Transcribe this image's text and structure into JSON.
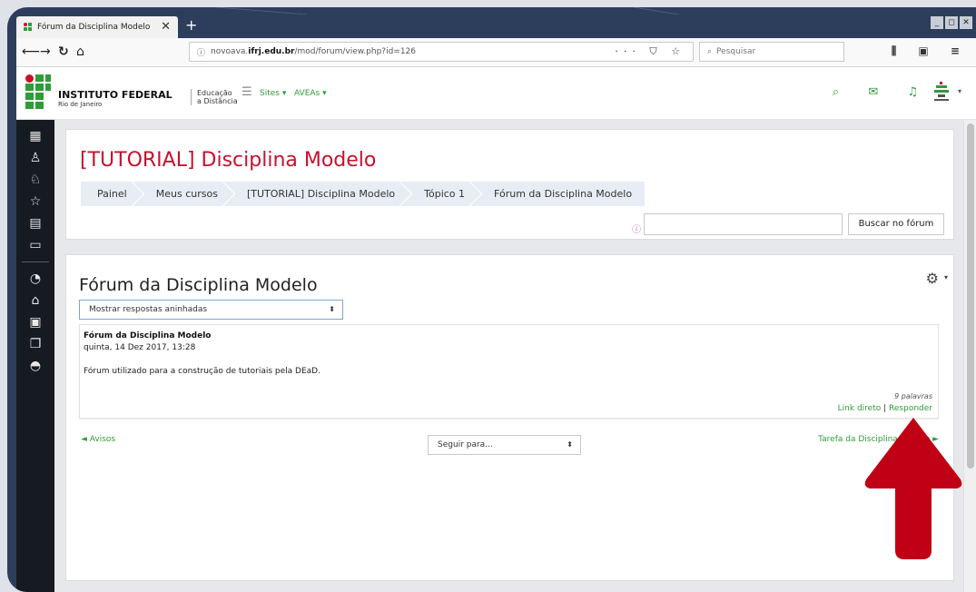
{
  "browser": {
    "tab_title": "Fórum da Disciplina Modelo",
    "tab_close": "✕",
    "new_tab": "+",
    "url_prefix": "novoava.",
    "url_domain": "ifrj.edu.br",
    "url_path": "/mod/forum/view.php?id=126",
    "search_placeholder": "Pesquisar",
    "url_icons": "··· ⛉ ☆",
    "nav_right_icons": "⫼ ▣ ≡"
  },
  "site": {
    "institute_name": "INSTITUTO FEDERAL",
    "institute_sub": "Rio de Janeiro",
    "ead_line1": "Educação",
    "ead_line2": "a Distância",
    "menu_sites": "Sites ▾",
    "menu_aveas": "AVEAs ▾",
    "header_icons": "⌕ ✉ ♫"
  },
  "drawer": {
    "icons": [
      "dashboard-icon",
      "users-icon",
      "badges-icon",
      "competencies-icon",
      "grades-icon",
      "folder-icon",
      "gauge-icon",
      "home-icon",
      "calendar-icon",
      "files-icon",
      "courses-icon"
    ]
  },
  "course": {
    "title": "[TUTORIAL] Disciplina Modelo",
    "breadcrumb": [
      "Painel",
      "Meus cursos",
      "[TUTORIAL] Disciplina Modelo",
      "Tópico 1",
      "Fórum da Disciplina Modelo"
    ],
    "search_button": "Buscar no fórum"
  },
  "forum": {
    "title": "Fórum da Disciplina Modelo",
    "display_mode": "Mostrar respostas aninhadas",
    "post": {
      "subject": "Fórum da Disciplina Modelo",
      "date": "quinta, 14 Dez 2017, 13:28",
      "message": "Fórum utilizado para a construção de tutoriais pela DEaD.",
      "words": "9 palavras",
      "link_direct": "Link direto",
      "link_sep": "|",
      "link_reply": "Responder"
    },
    "prev_activity": "◄ Avisos",
    "goto_placeholder": "Seguir para...",
    "next_activity": "Tarefa da Disciplina Modelo ►"
  },
  "colors": {
    "accent_green": "#2f9b3a",
    "title_red": "#c8102e",
    "arrow_red": "#c00014"
  }
}
